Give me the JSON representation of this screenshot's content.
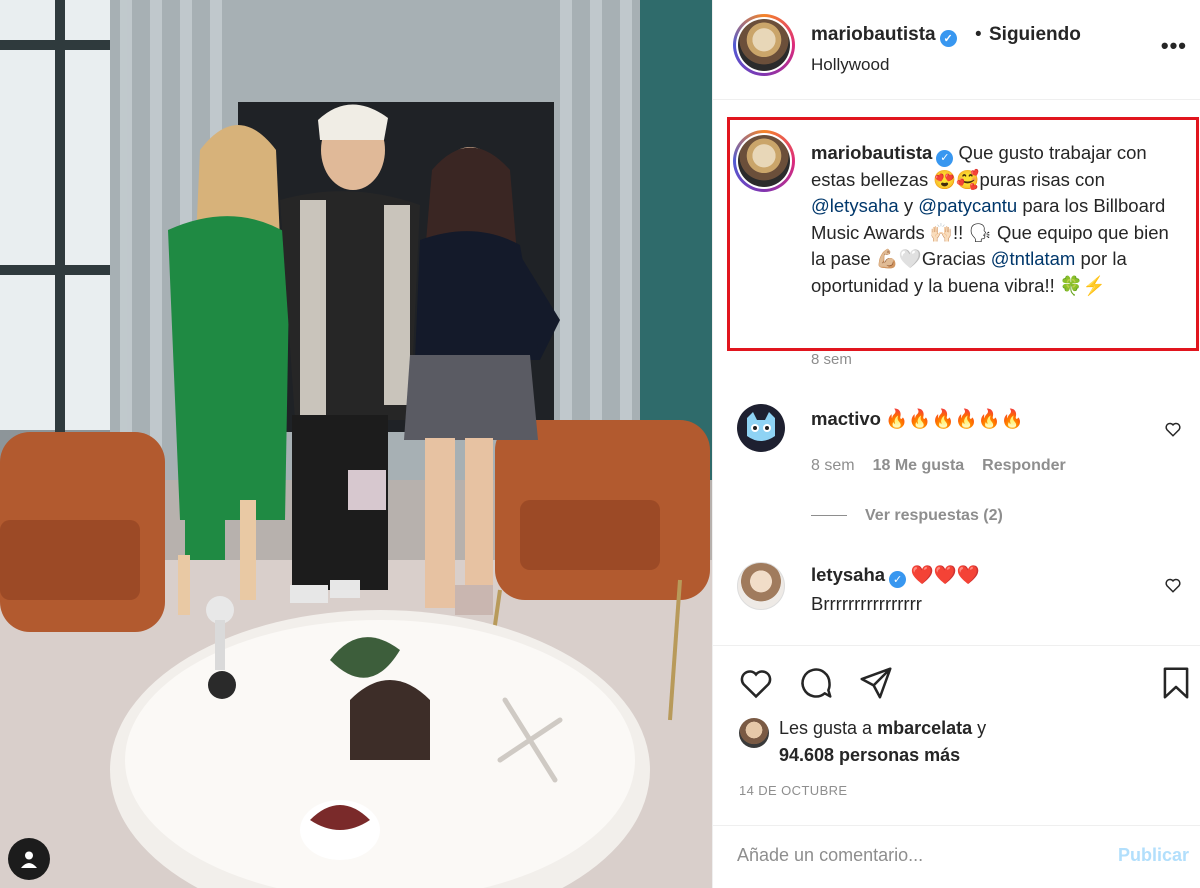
{
  "header": {
    "username": "mariobautista",
    "separator": "•",
    "follow_status": "Siguiendo",
    "location": "Hollywood",
    "more_icon": "more-horizontal-icon"
  },
  "caption": {
    "username": "mariobautista",
    "text_1": " Que gusto trabajar con estas bellezas 😍🥰puras risas con ",
    "mention_1": "@letysaha",
    "text_2": " y ",
    "mention_2": "@patycantu",
    "text_3": " para los Billboard Music Awards 🙌🏻!! 🗣 Que equipo que bien la pase 💪🏼🤍Gracias ",
    "mention_3": "@tntlatam",
    "text_4": " por la oportunidad y la buena vibra!! 🍀⚡",
    "time": "8 sem",
    "highlight_color": "#e1151e"
  },
  "comments": [
    {
      "username": "mactivo",
      "text": "🔥🔥🔥🔥🔥🔥",
      "time": "8 sem",
      "likes": "18 Me gusta",
      "reply": "Responder",
      "view_replies": "Ver respuestas (2)"
    },
    {
      "username": "letysaha",
      "text": "❤️❤️❤️",
      "body": "Brrrrrrrrrrrrrrrr"
    }
  ],
  "likes": {
    "prefix": "Les gusta a ",
    "user": "mbarcelata",
    "suffix": " y",
    "others": "94.608 personas más"
  },
  "date": "14 DE OCTUBRE",
  "comment_box": {
    "placeholder": "Añade un comentario...",
    "publish": "Publicar"
  },
  "colors": {
    "mention": "#00376b",
    "secondary": "#8e8e8e",
    "verified": "#3897f0",
    "publish_disabled": "#b2dffc"
  }
}
